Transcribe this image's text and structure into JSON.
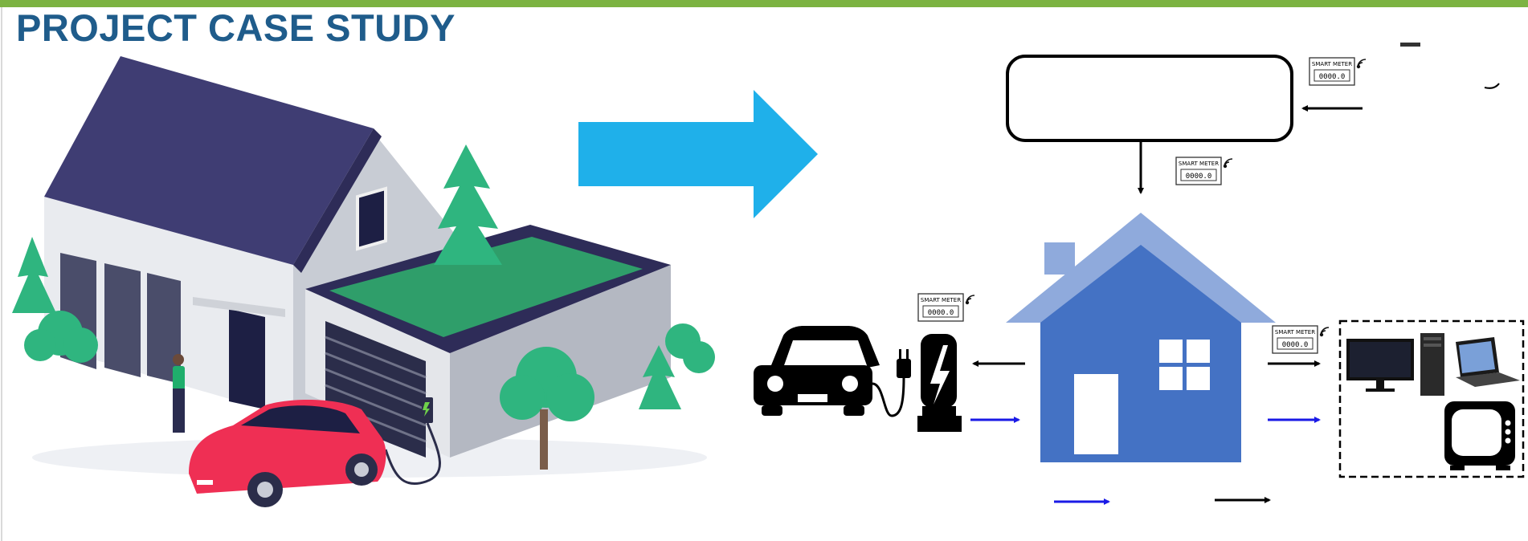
{
  "header": {
    "title": "PROJECT CASE STUDY",
    "bar_color": "#7cb342",
    "title_color": "#1f5c8b"
  },
  "colors": {
    "arrow_blue": "#1fb0ea",
    "house_body": "#4472c4",
    "house_roof": "#8faadc",
    "flow_blue": "#1a1ae6",
    "flow_black": "#000000",
    "roof_dark": "#3f3d73",
    "car_red": "#ef2f54",
    "tree_green": "#2fb57f",
    "grass_green": "#2f9e6a"
  },
  "diagram": {
    "meters": [
      {
        "label": "SMART METER",
        "reading": "0000.0"
      },
      {
        "label": "SMART METER",
        "reading": "0000.0"
      },
      {
        "label": "SMART METER",
        "reading": "0000.0"
      },
      {
        "label": "SMART METER",
        "reading": "0000.0"
      }
    ]
  },
  "icons": {
    "illustration": "house-with-ev-illustration",
    "big_arrow": "right-arrow-icon",
    "ev": "car-icon",
    "charger": "ev-charger-icon",
    "home": "house-icon",
    "devices": [
      "monitor-icon",
      "pc-tower-icon",
      "laptop-icon",
      "tv-icon"
    ],
    "wifi": "wifi-icon"
  }
}
